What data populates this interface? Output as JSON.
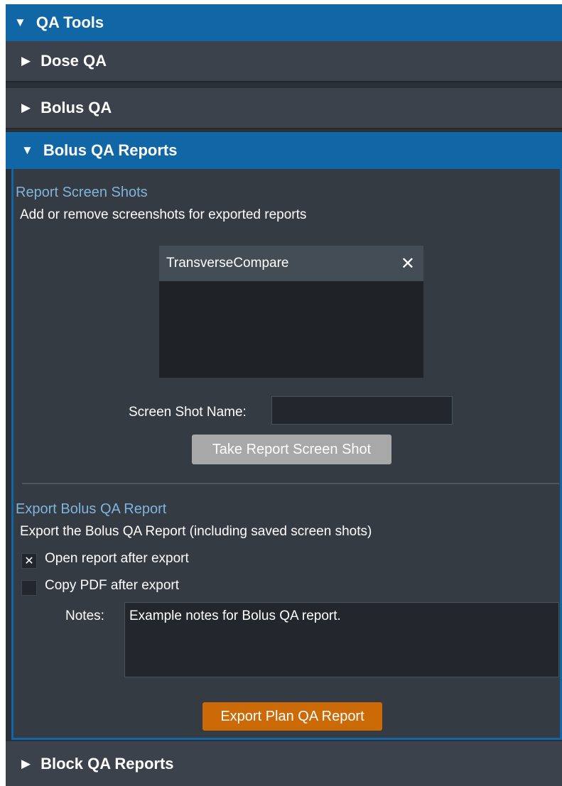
{
  "qa_tools": {
    "label": "QA Tools",
    "expanded": true
  },
  "sections": {
    "dose_qa": {
      "label": "Dose QA"
    },
    "bolus_qa": {
      "label": "Bolus QA"
    },
    "bolus_qa_reports": {
      "label": "Bolus QA Reports"
    },
    "block_qa_reports": {
      "label": "Block QA Reports"
    }
  },
  "report_screenshots": {
    "title": "Report Screen Shots",
    "description": "Add or remove screenshots for exported reports",
    "items": [
      {
        "name": "TransverseCompare"
      }
    ],
    "name_label": "Screen Shot Name:",
    "name_value": "",
    "take_button": "Take Report Screen Shot"
  },
  "export": {
    "title": "Export Bolus QA Report",
    "description": "Export the Bolus QA Report (including saved screen shots)",
    "open_after_export": {
      "label": "Open report after export",
      "checked": true,
      "mark": "✕"
    },
    "copy_pdf": {
      "label": "Copy PDF after export",
      "checked": false
    },
    "notes_label": "Notes:",
    "notes_value": "Example notes for Bolus QA report.",
    "export_button": "Export Plan QA Report"
  },
  "icons": {
    "expanded": "triangle-down-icon",
    "collapsed": "triangle-right-icon",
    "close": "close-icon",
    "check": "check-x-icon"
  },
  "colors": {
    "header_blue": "#1166a6",
    "panel_dark": "#2a3038",
    "section_grey": "#3b424b",
    "link_blue": "#7fb4dd",
    "export_orange": "#cc6a08",
    "button_grey": "#a8a8a8"
  }
}
